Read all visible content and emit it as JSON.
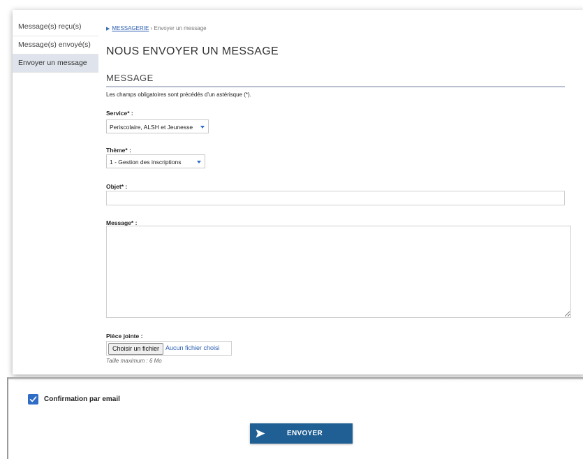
{
  "sidebar": {
    "items": [
      {
        "label": "Message(s) reçu(s)"
      },
      {
        "label": "Message(s) envoyé(s)"
      },
      {
        "label": "Envoyer un message"
      }
    ]
  },
  "breadcrumb": {
    "root": "MESSAGERIE",
    "separator": "›",
    "current": "Envoyer un message"
  },
  "page_title": "NOUS ENVOYER UN MESSAGE",
  "section_title": "MESSAGE",
  "required_info": "Les champs obligatoires sont précédés d'un astérisque (*).",
  "form": {
    "service": {
      "label": "Service* :",
      "value": "Periscolaire, ALSH et Jeunesse"
    },
    "theme": {
      "label": "Thème* :",
      "value": "1 - Gestion des inscriptions"
    },
    "objet": {
      "label": "Objet* :",
      "value": ""
    },
    "message": {
      "label": "Message* :",
      "value": ""
    },
    "attachment": {
      "label": "Pièce jointe :",
      "button": "Choisir un fichier",
      "file_name": "Aucun fichier choisi",
      "size_note": "Taille maximum : 6 Mo"
    }
  },
  "confirmation": {
    "label": "Confirmation par email",
    "checked": true
  },
  "send_button": {
    "label": "ENVOYER"
  },
  "colors": {
    "accent": "#2f6cc6",
    "button": "#1f5f94",
    "sidebar_active": "#dfe4ec"
  }
}
